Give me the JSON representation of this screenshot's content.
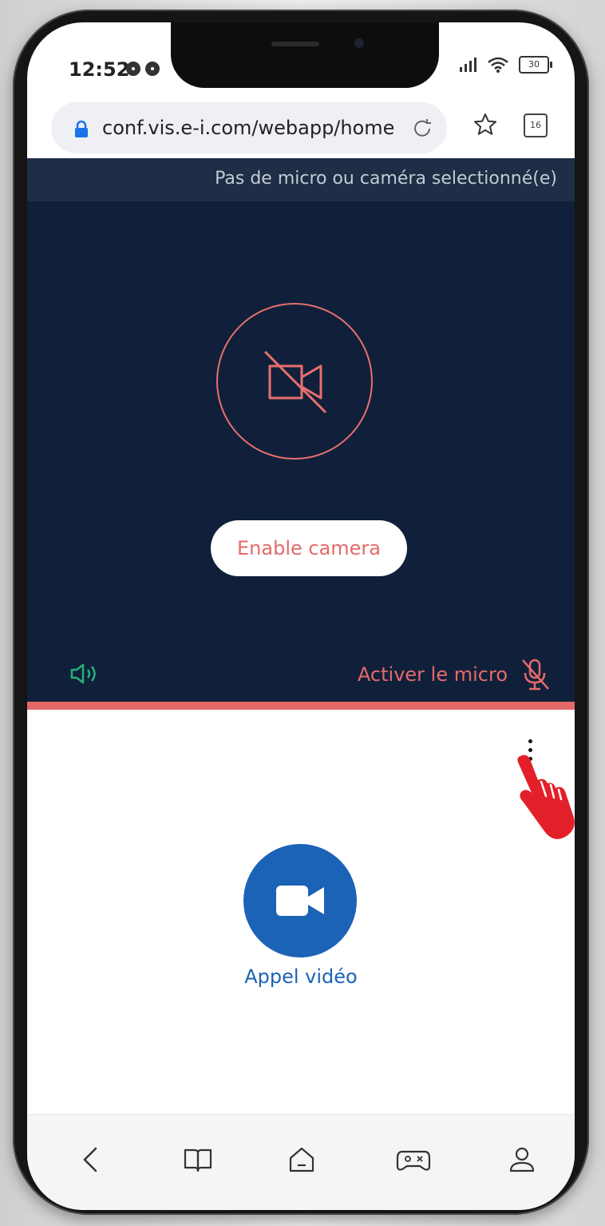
{
  "status_bar": {
    "time": "12:52",
    "battery": "30"
  },
  "browser": {
    "url": "conf.vis.e-i.com/webapp/home",
    "tab_count": "16"
  },
  "video_panel": {
    "notice": "Pas de micro ou caméra selectionné(e)",
    "enable_camera_label": "Enable camera",
    "mic_label": "Activer le micro"
  },
  "call": {
    "label": "Appel vidéo"
  },
  "colors": {
    "panel_dark": "#10203a",
    "accent_red": "#e46a6a",
    "call_blue": "#1b63b6",
    "speaker_green": "#26b07a"
  },
  "icons": {
    "lock": "lock-icon",
    "reload": "reload-icon",
    "star": "star-icon",
    "tabs": "tabs-icon",
    "camera_off": "camera-off-icon",
    "speaker": "speaker-icon",
    "mic_off": "mic-off-icon",
    "more": "more-vertical-icon",
    "video": "video-camera-icon",
    "back": "back-icon",
    "book": "book-icon",
    "home": "home-icon",
    "game": "game-icon",
    "profile": "profile-icon"
  }
}
